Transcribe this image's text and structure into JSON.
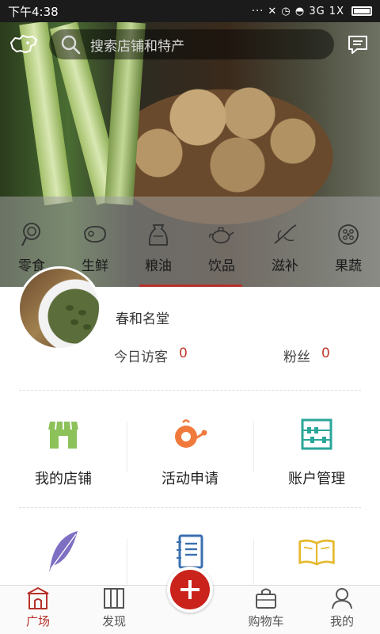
{
  "status_bar": {
    "time": "下午4:38",
    "right_text": "··· ✕ ◷ ◓ 3G 1X"
  },
  "search": {
    "placeholder": "搜索店铺和特产"
  },
  "categories": [
    {
      "label": "零食",
      "icon": "lollipop-icon"
    },
    {
      "label": "生鲜",
      "icon": "meat-icon"
    },
    {
      "label": "粮油",
      "icon": "rice-sack-icon"
    },
    {
      "label": "饮品",
      "icon": "teapot-icon"
    },
    {
      "label": "滋补",
      "icon": "ginseng-icon"
    },
    {
      "label": "果蔬",
      "icon": "fruit-icon"
    }
  ],
  "shop": {
    "name": "春和名堂",
    "visitors_label": "今日访客",
    "visitors_value": "0",
    "fans_label": "粉丝",
    "fans_value": "0"
  },
  "grid": [
    {
      "label": "我的店铺",
      "icon": "storefront-icon",
      "color": "#8dc15a"
    },
    {
      "label": "活动申请",
      "icon": "activity-icon",
      "color": "#f07a3c"
    },
    {
      "label": "账户管理",
      "icon": "abacus-icon",
      "color": "#2aa69a"
    },
    {
      "label": "",
      "icon": "feather-icon",
      "color": "#7e6fc2"
    },
    {
      "label": "",
      "icon": "notebook-icon",
      "color": "#3a6fb0"
    },
    {
      "label": "",
      "icon": "book-icon",
      "color": "#e6b92c"
    }
  ],
  "bottom_nav": [
    {
      "label": "广场",
      "icon": "plaza-icon",
      "active": true
    },
    {
      "label": "发现",
      "icon": "discover-icon",
      "active": false
    },
    {
      "label": "",
      "icon": "add-icon",
      "active": false
    },
    {
      "label": "购物车",
      "icon": "cart-icon",
      "active": false
    },
    {
      "label": "我的",
      "icon": "profile-icon",
      "active": false
    }
  ],
  "colors": {
    "accent": "#c9231c",
    "status_bar": "#1b1b1b"
  }
}
